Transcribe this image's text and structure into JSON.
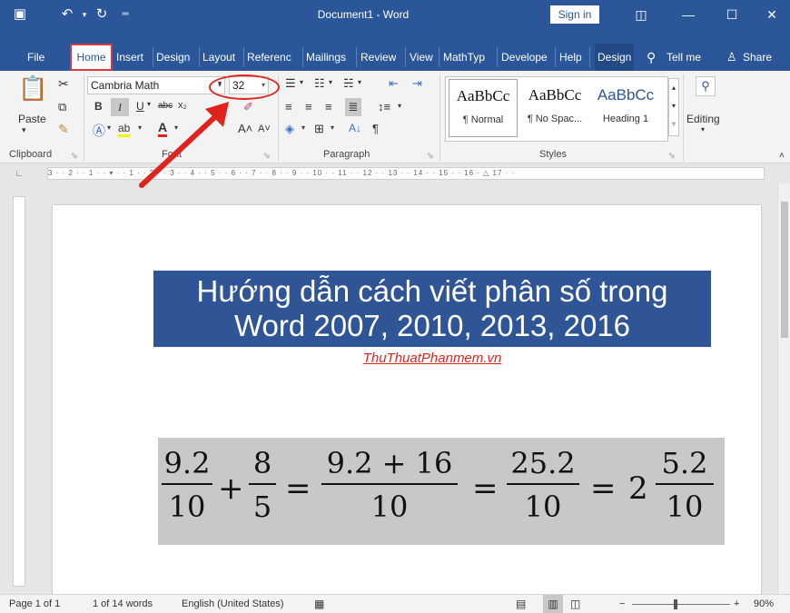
{
  "window": {
    "title": "Document1 - Word",
    "sign_in": "Sign in"
  },
  "tabs": [
    "File",
    "Home",
    "Insert",
    "Design",
    "Layout",
    "Referenc",
    "Mailings",
    "Review",
    "View",
    "MathTyp",
    "Develope",
    "Help",
    "Design"
  ],
  "tell_me": "Tell me",
  "share": "Share",
  "font": {
    "name": "Cambria Math",
    "size": "32"
  },
  "groups": {
    "clipboard": "Clipboard",
    "font": "Font",
    "paragraph": "Paragraph",
    "styles": "Styles",
    "editing": "Editing",
    "paste": "Paste"
  },
  "styles": [
    {
      "sample": "AaBbCc",
      "name": "¶ Normal"
    },
    {
      "sample": "AaBbCc",
      "name": "¶ No Spac..."
    },
    {
      "sample": "AaBbCc",
      "name": "Heading 1"
    }
  ],
  "document": {
    "heading_line1": "Hướng dẫn cách viết phân số trong",
    "heading_line2": "Word 2007, 2010, 2013, 2016",
    "link": "ThuThuatPhanmem.vn",
    "equation": {
      "f1_num": "9.2",
      "f1_den": "10",
      "plus": "+",
      "f2_num": "8",
      "f2_den": "5",
      "eq": "=",
      "f3_num": "9.2 + 16",
      "f3_den": "10",
      "f4_num": "25.2",
      "f4_den": "10",
      "whole": "2",
      "f5_num": "5.2",
      "f5_den": "10"
    }
  },
  "status": {
    "page": "Page 1 of 1",
    "words": "1 of 14 words",
    "language": "English (United States)",
    "zoom": "90%"
  },
  "colors": {
    "accent": "#2b579a",
    "heading_bg": "#2f5597",
    "annotation": "#e0241d"
  }
}
